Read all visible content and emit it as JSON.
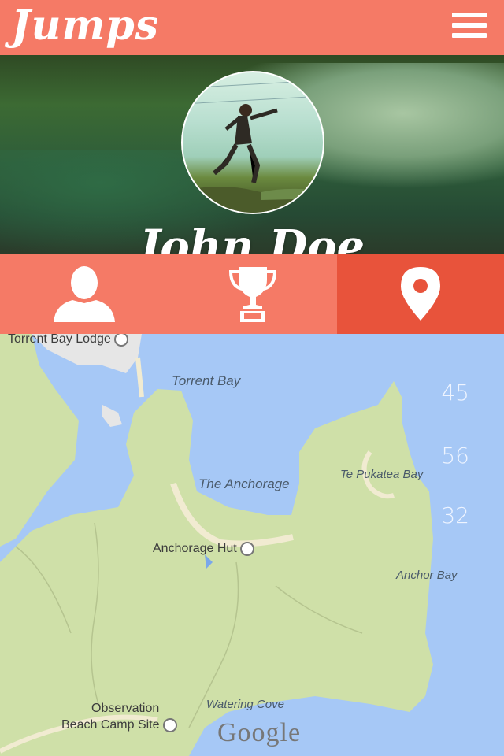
{
  "app": {
    "title": "Jumps",
    "menu_icon": "hamburger-menu-icon"
  },
  "profile": {
    "name": "John Doe",
    "avatar_icon": "profile-photo"
  },
  "tabs": [
    {
      "icon": "user-icon",
      "active": false
    },
    {
      "icon": "trophy-icon",
      "active": false
    },
    {
      "icon": "location-pin-icon",
      "active": true
    }
  ],
  "map": {
    "labels": {
      "torrent_bay_lodge": "Torrent Bay Lodge",
      "torrent_bay": "Torrent Bay",
      "the_anchorage": "The Anchorage",
      "te_pukatea_bay": "Te Pukatea Bay",
      "anchorage_hut": "Anchorage Hut",
      "anchor_bay": "Anchor Bay",
      "observation_line1": "Observation",
      "observation_line2": "Beach Camp Site",
      "watering_cove": "Watering Cove"
    },
    "attribution": "Google",
    "stats": [
      "45",
      "56",
      "32"
    ]
  },
  "colors": {
    "accent": "#f57a66",
    "accent_dark": "#e8533b",
    "water": "#a6c8f6",
    "land": "#cfe0a8"
  }
}
